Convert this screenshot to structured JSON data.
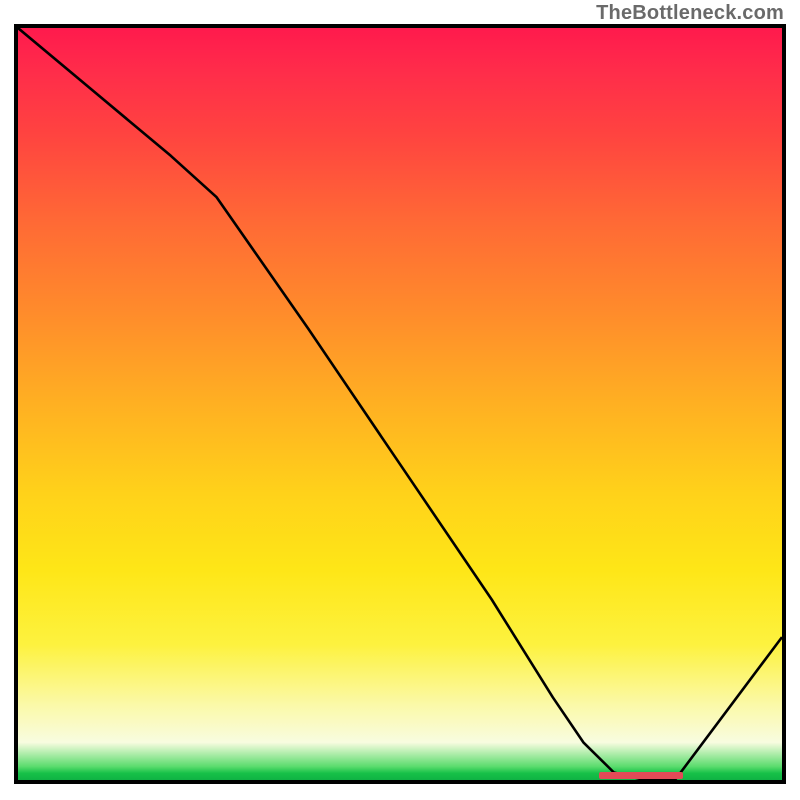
{
  "watermark": "TheBottleneck.com",
  "chart_data": {
    "type": "line",
    "title": "",
    "xlabel": "",
    "ylabel": "",
    "xlim": [
      0,
      100
    ],
    "ylim": [
      0,
      100
    ],
    "grid": false,
    "legend": false,
    "series": [
      {
        "name": "bottleneck-curve",
        "x": [
          0,
          10,
          20,
          26,
          38,
          50,
          62,
          70,
          74,
          78,
          82,
          86,
          100
        ],
        "y": [
          100,
          91.5,
          83,
          77.5,
          60,
          42,
          24,
          11,
          5,
          1,
          0,
          0,
          19
        ]
      }
    ],
    "marker": {
      "name": "optimal-range",
      "x_start": 76,
      "x_end": 87,
      "y": 0.6
    }
  },
  "colors": {
    "curve": "#000000",
    "marker": "#e24a57",
    "frame": "#000000",
    "watermark": "#6a6a6a"
  }
}
